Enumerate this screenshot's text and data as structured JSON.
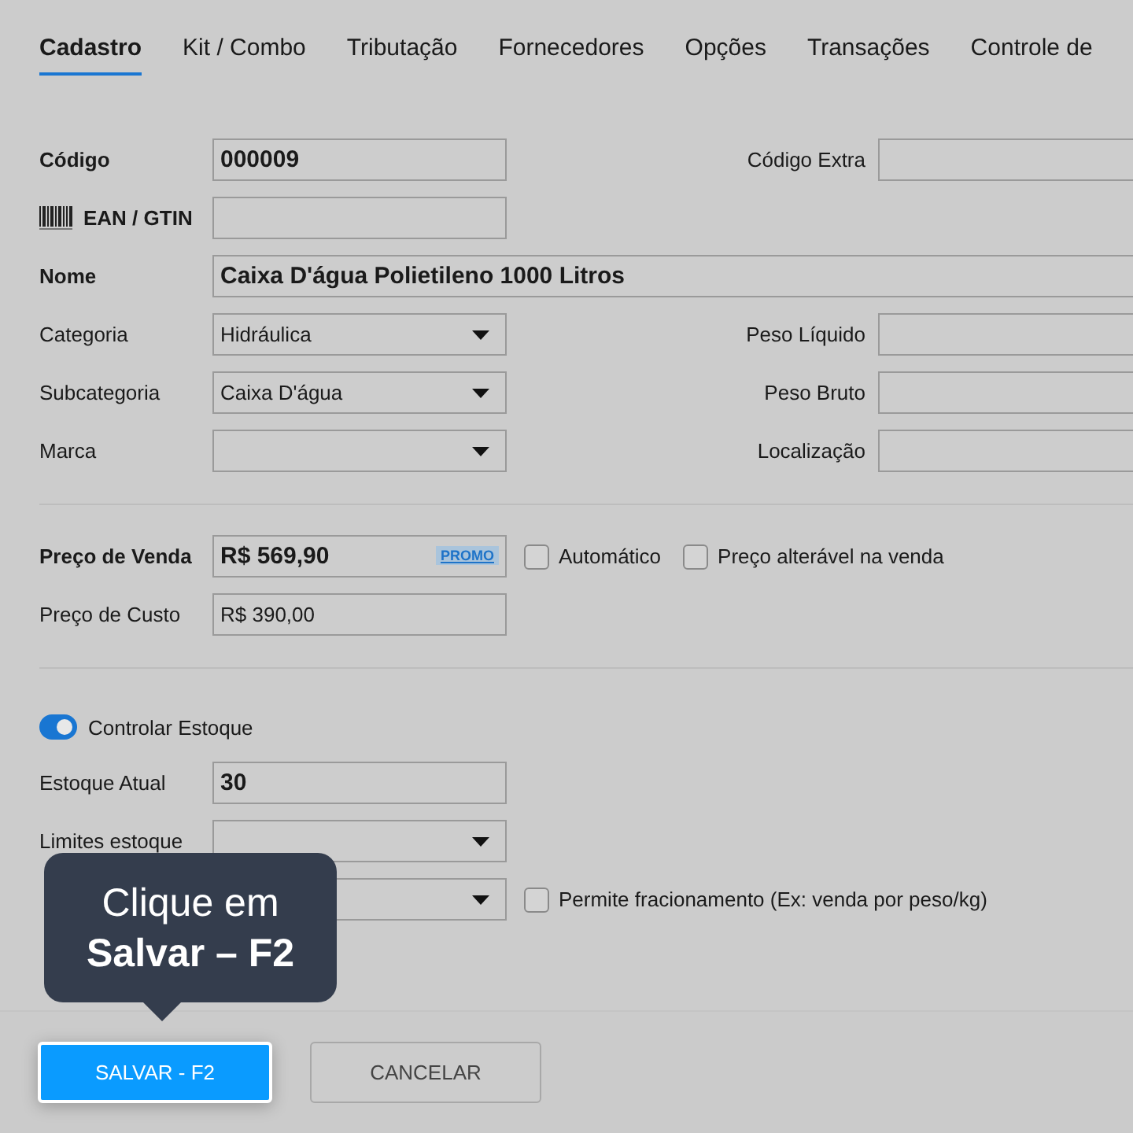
{
  "tabs": [
    {
      "label": "Cadastro",
      "selected": true
    },
    {
      "label": "Kit / Combo",
      "selected": false
    },
    {
      "label": "Tributação",
      "selected": false
    },
    {
      "label": "Fornecedores",
      "selected": false
    },
    {
      "label": "Opções",
      "selected": false
    },
    {
      "label": "Transações",
      "selected": false
    },
    {
      "label": "Controle de",
      "selected": false
    }
  ],
  "sections": [
    {
      "rows": [
        {
          "kind": "text",
          "label": "Código",
          "strong": true,
          "value": "000009",
          "value_bold": true,
          "right": {
            "label": "Código Extra"
          }
        },
        {
          "kind": "barcode",
          "label": "EAN / GTIN",
          "strong": true
        },
        {
          "kind": "wide",
          "label": "Nome",
          "strong": true,
          "value": "Caixa D'água Polietileno 1000 Litros",
          "value_bold": true
        },
        {
          "kind": "select",
          "label": "Categoria",
          "strong": false,
          "value": "Hidráulica",
          "value_bold": false,
          "right": {
            "label": "Peso Líquido"
          }
        },
        {
          "kind": "select",
          "label": "Subcategoria",
          "strong": false,
          "value": "Caixa D'água",
          "value_bold": false,
          "right": {
            "label": "Peso Bruto"
          }
        },
        {
          "kind": "select",
          "label": "Marca",
          "strong": false,
          "right": {
            "label": "Localização"
          }
        }
      ]
    },
    {
      "rows": [
        {
          "kind": "price",
          "label": "Preço de Venda",
          "strong": true,
          "value": "R$ 569,90",
          "value_bold": true,
          "badge": "PROMO",
          "checks": [
            {
              "label": "Automático",
              "checked": false
            },
            {
              "label": "Preço alterável na venda",
              "checked": false
            }
          ]
        },
        {
          "kind": "text",
          "label": "Preço de Custo",
          "strong": false,
          "value": "R$ 390,00",
          "value_bold": false
        }
      ]
    },
    {
      "rows": [
        {
          "kind": "toggle",
          "label": "Controlar Estoque",
          "on": true
        },
        {
          "kind": "text",
          "label": "Estoque Atual",
          "strong": false,
          "value": "30",
          "value_bold": true
        },
        {
          "kind": "select",
          "label": "Limites estoque",
          "strong": false
        },
        {
          "kind": "select",
          "checks": [
            {
              "label": "Permite fracionamento (Ex: venda por peso/kg)",
              "checked": false
            }
          ]
        }
      ]
    }
  ],
  "tooltip": {
    "lines": [
      "Clique em",
      "Salvar – F2"
    ]
  },
  "buttons": [
    {
      "label": "SALVAR - F2",
      "kind": "primary"
    },
    {
      "label": "CANCELAR",
      "kind": "secondary"
    }
  ]
}
